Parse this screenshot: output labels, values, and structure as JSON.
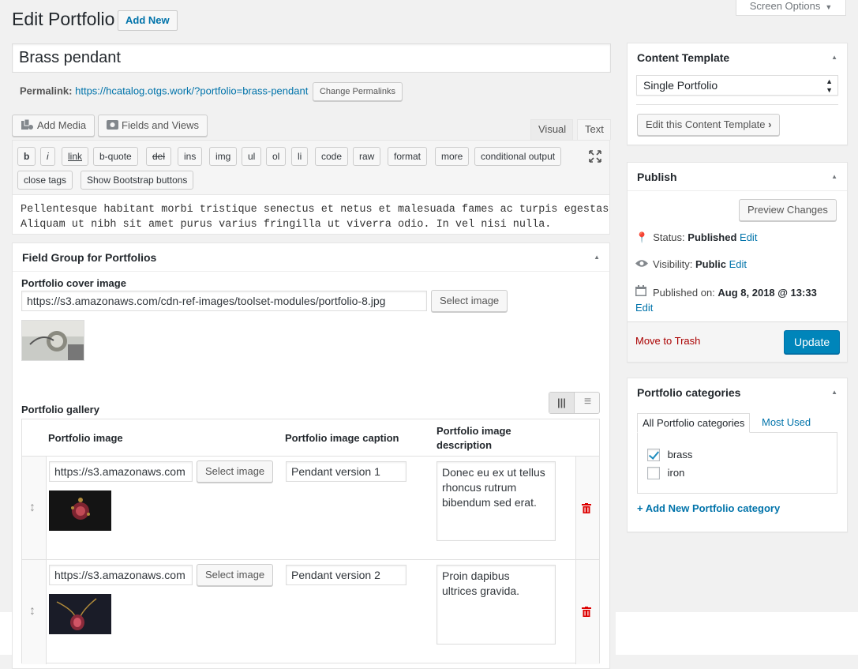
{
  "header": {
    "title": "Edit Portfolio",
    "add_new": "Add New",
    "screen_options": "Screen Options"
  },
  "post": {
    "title": "Brass pendant",
    "permalink_label": "Permalink:",
    "permalink_url": "https://hcatalog.otgs.work/?portfolio=brass-pendant",
    "change_permalinks": "Change Permalinks"
  },
  "editor": {
    "add_media": "Add Media",
    "fields_and_views": "Fields and Views",
    "tab_visual": "Visual",
    "tab_text": "Text",
    "quicktags": [
      "b",
      "i",
      "link",
      "b-quote",
      "del",
      "ins",
      "img",
      "ul",
      "ol",
      "li",
      "code",
      "raw",
      "format",
      "more",
      "conditional output",
      "close tags",
      "Show Bootstrap buttons"
    ],
    "content_line1": "Pellentesque habitant morbi tristique senectus et netus et malesuada fames ac turpis egestas.",
    "content_line2": "Aliquam ut nibh sit amet purus varius fringilla ut viverra odio. In vel nisi nulla."
  },
  "field_group": {
    "title": "Field Group for Portfolios",
    "cover_label": "Portfolio cover image",
    "cover_url": "https://s3.amazonaws.com/cdn-ref-images/toolset-modules/portfolio-8.jpg",
    "select_image": "Select image",
    "gallery_label": "Portfolio gallery",
    "columns": {
      "image": "Portfolio image",
      "caption": "Portfolio image caption",
      "description_1": "Portfolio image",
      "description_2": "description"
    },
    "rows": [
      {
        "url": "https://s3.amazonaws.com",
        "caption": "Pendant version 1",
        "desc_1": "Donec eu ex ut tellus",
        "desc_2": "rhoncus rutrum",
        "desc_3": "bibendum sed erat."
      },
      {
        "url": "https://s3.amazonaws.com",
        "caption": "Pendant version 2",
        "desc_1": "Proin dapibus",
        "desc_2": "ultrices gravida.",
        "desc_3": ""
      }
    ]
  },
  "content_template": {
    "title": "Content Template",
    "selected": "Single Portfolio",
    "edit_button": "Edit this Content Template"
  },
  "publish": {
    "title": "Publish",
    "preview": "Preview Changes",
    "status_label": "Status:",
    "status_value": "Published",
    "visibility_label": "Visibility:",
    "visibility_value": "Public",
    "published_label": "Published on:",
    "published_value": "Aug 8, 2018 @ 13:33",
    "edit": "Edit",
    "trash": "Move to Trash",
    "update": "Update"
  },
  "categories": {
    "title": "Portfolio categories",
    "tab_all": "All Portfolio categories",
    "tab_most_used": "Most Used",
    "items": [
      {
        "label": "brass",
        "checked": true
      },
      {
        "label": "iron",
        "checked": false
      }
    ],
    "add_new": "+ Add New Portfolio category"
  },
  "colors": {
    "accent": "#0073aa",
    "primary_button": "#0085ba",
    "trash_link": "#a00",
    "delete_icon": "#d00"
  }
}
